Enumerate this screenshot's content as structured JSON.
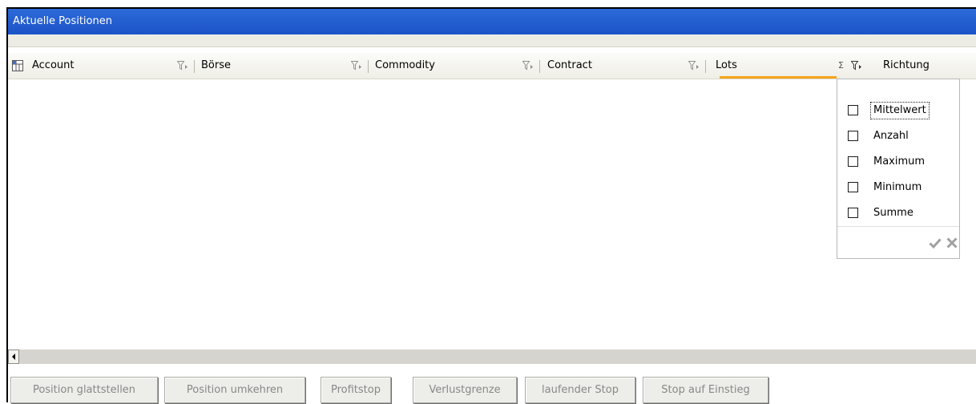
{
  "window": {
    "title": "Aktuelle Positionen"
  },
  "columns": [
    {
      "label": "Account"
    },
    {
      "label": "Börse"
    },
    {
      "label": "Commodity"
    },
    {
      "label": "Contract"
    },
    {
      "label": "Lots",
      "sum_symbol": "Σ"
    },
    {
      "label": "Richtung"
    }
  ],
  "aggregate_menu": {
    "options": [
      {
        "label": "Mittelwert",
        "checked": false,
        "focused": true
      },
      {
        "label": "Anzahl",
        "checked": false
      },
      {
        "label": "Maximum",
        "checked": false
      },
      {
        "label": "Minimum",
        "checked": false
      },
      {
        "label": "Summe",
        "checked": false
      }
    ],
    "confirm_icon": "check-icon",
    "cancel_icon": "close-icon"
  },
  "buttons": [
    {
      "label": "Position glattstellen",
      "enabled": false
    },
    {
      "label": "Position umkehren",
      "enabled": false
    },
    {
      "label": "Profitstop",
      "enabled": false
    },
    {
      "label": "Verlustgrenze",
      "enabled": false
    },
    {
      "label": "laufender Stop",
      "enabled": false
    },
    {
      "label": "Stop auf Einstieg",
      "enabled": false
    }
  ],
  "colors": {
    "title_bar": "#1f5bcb",
    "sort_accent": "#f5a51d",
    "disabled_text": "#888888"
  }
}
